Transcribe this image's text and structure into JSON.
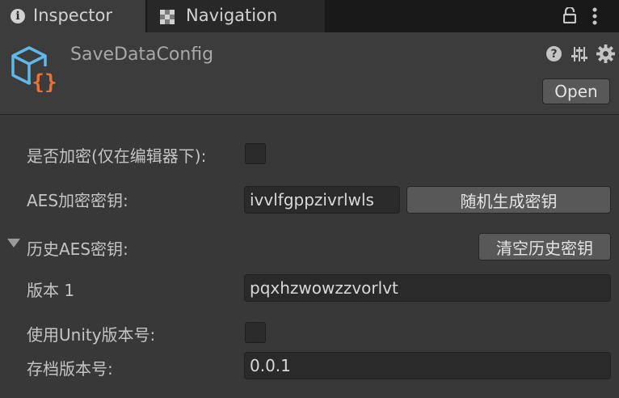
{
  "tabs": {
    "inspector": {
      "label": "Inspector",
      "icon": "info-icon"
    },
    "navigation": {
      "label": "Navigation",
      "icon": "navigation-icon"
    }
  },
  "header": {
    "asset_title": "SaveDataConfig",
    "open_label": "Open",
    "help_glyph": "?",
    "asset_icon_glyph": "{}"
  },
  "fields": {
    "encrypt_label": "是否加密(仅在编辑器下):",
    "aes_key_label": "AES加密密钥:",
    "aes_key_value": "ivvlfgppzivrlwls",
    "random_key_button": "随机生成密钥",
    "history_label": "历史AES密钥:",
    "clear_history_button": "清空历史密钥",
    "version_1_label": "版本 1",
    "version_1_value": "pqxhzwowzzvorlvt",
    "use_unity_version_label": "使用Unity版本号:",
    "save_version_label": "存档版本号:",
    "save_version_value": "0.0.1"
  },
  "colors": {
    "background": "#383838",
    "tabbar": "#191919",
    "field_bg": "#2a2a2a",
    "button_bg": "#585858",
    "icon_blue": "#5fb8e8",
    "icon_orange": "#e8703a"
  }
}
